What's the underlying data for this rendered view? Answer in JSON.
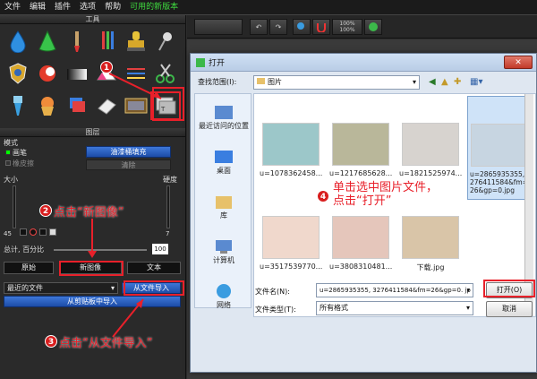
{
  "menubar": {
    "items": [
      "文件",
      "编辑",
      "插件",
      "选项",
      "帮助"
    ],
    "promo": "可用的新版本"
  },
  "tools_panel": {
    "title": "工具"
  },
  "layers_panel": {
    "title": "图层",
    "mode_label": "模式",
    "brush_label": "画笔",
    "eraser_label": "橡皮擦",
    "fill_button": "油漆桶填充",
    "clear_button": "清除",
    "size_label": "大小",
    "hardness_label": "硬度",
    "size_value": "45",
    "hardness_value": "7",
    "opacity_label": "总计, 百分比",
    "opacity_value": "100",
    "tabs": [
      "原始",
      "新图像",
      "文本"
    ],
    "recent_files": "最近的文件",
    "import_file_button": "从文件导入",
    "import_clipboard_button": "从剪贴板中导入"
  },
  "toolbar": {
    "zoom_top": "100%",
    "zoom_bottom": "100%"
  },
  "dialog": {
    "title": "打开",
    "close_label": "✕",
    "lookin_label": "查找范围(I):",
    "lookin_value": "图片",
    "places": [
      "最近访问的位置",
      "桌面",
      "库",
      "计算机",
      "网络"
    ],
    "files": [
      {
        "name": "u=1078362458...",
        "color": "#9cc7c9"
      },
      {
        "name": "u=1217685628...",
        "color": "#b9b79a"
      },
      {
        "name": "u=1821525974...",
        "color": "#d7d3cf"
      },
      {
        "name": "u=2865935355,3276411584&fm=26&gp=0.jpg",
        "color": "#c7d5e1"
      },
      {
        "name": "u=3517539770...",
        "color": "#f0d8cc"
      },
      {
        "name": "u=3808310481...",
        "color": "#e5c6bb"
      },
      {
        "name": "下载.jpg",
        "color": "#d9c5a8"
      }
    ],
    "filename_label": "文件名(N):",
    "filename_value": "u=2865935355, 3276411584&fm=26&gp=0. jp",
    "filetype_label": "文件类型(T):",
    "filetype_value": "所有格式",
    "open_button": "打开(O)",
    "cancel_button": "取消"
  },
  "annotations": {
    "step1": "1",
    "step2": "2",
    "step2_text": "点击“新图像”",
    "step3": "3",
    "step3_text": "点击“从文件导入”",
    "step4": "4",
    "step4_line1": "单击选中图片文件，",
    "step4_line2": "点击“打开”"
  }
}
